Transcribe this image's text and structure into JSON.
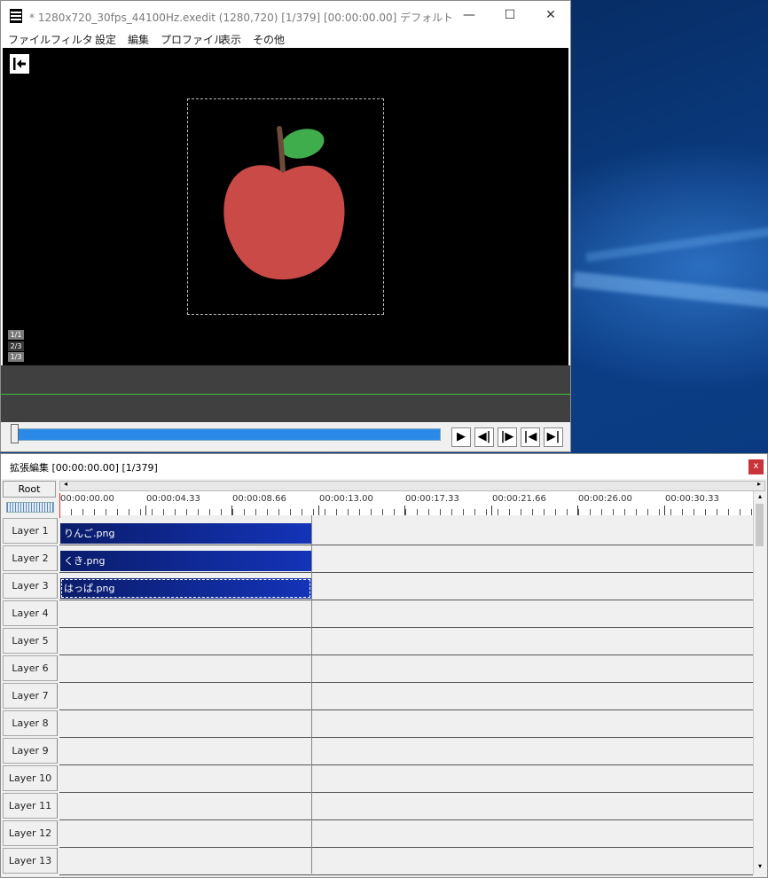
{
  "main_window": {
    "title": "* 1280x720_30fps_44100Hz.exedit (1280,720)  [1/379] [00:00:00.00]  デフォルト",
    "controls": {
      "minimize": "—",
      "maximize": "☐",
      "close": "✕"
    },
    "menu": [
      "ファイル",
      "フィルタ",
      "設定",
      "編集",
      "プロファイル",
      "表示",
      "その他"
    ],
    "preview": {
      "indicators": [
        "1/1",
        "2/3",
        "1/3"
      ],
      "apple_color": "#c94a46",
      "leaf_color": "#3fad4b",
      "stem_color": "#6e4a3a"
    },
    "playback": {
      "play": "▶",
      "prev_frame": "◀|",
      "next_frame": "|▶",
      "to_start": "|◀",
      "to_end": "▶|"
    },
    "accent_color": "#2b8ae8"
  },
  "timeline": {
    "title": "拡張編集 [00:00:00.00] [1/379]",
    "close_label": "x",
    "root_label": "Root",
    "scroll_left": "◂",
    "scroll_right": "▸",
    "scroll_up": "▴",
    "scroll_down": "▾",
    "ruler": [
      "00:00:00.00",
      "00:00:04.33",
      "00:00:08.66",
      "00:00:13.00",
      "00:00:17.33",
      "00:00:21.66",
      "00:00:26.00",
      "00:00:30.33"
    ],
    "layers": [
      "Layer  1",
      "Layer  2",
      "Layer  3",
      "Layer  4",
      "Layer  5",
      "Layer  6",
      "Layer  7",
      "Layer  8",
      "Layer  9",
      "Layer 10",
      "Layer 11",
      "Layer 12",
      "Layer 13"
    ],
    "clips": [
      {
        "label": "りんご.png",
        "layer": 1
      },
      {
        "label": "くき.png",
        "layer": 2
      },
      {
        "label": "はっぱ.png",
        "layer": 3,
        "selected": true
      }
    ],
    "clip_color": "#1434b8",
    "close_color": "#c8343a"
  }
}
